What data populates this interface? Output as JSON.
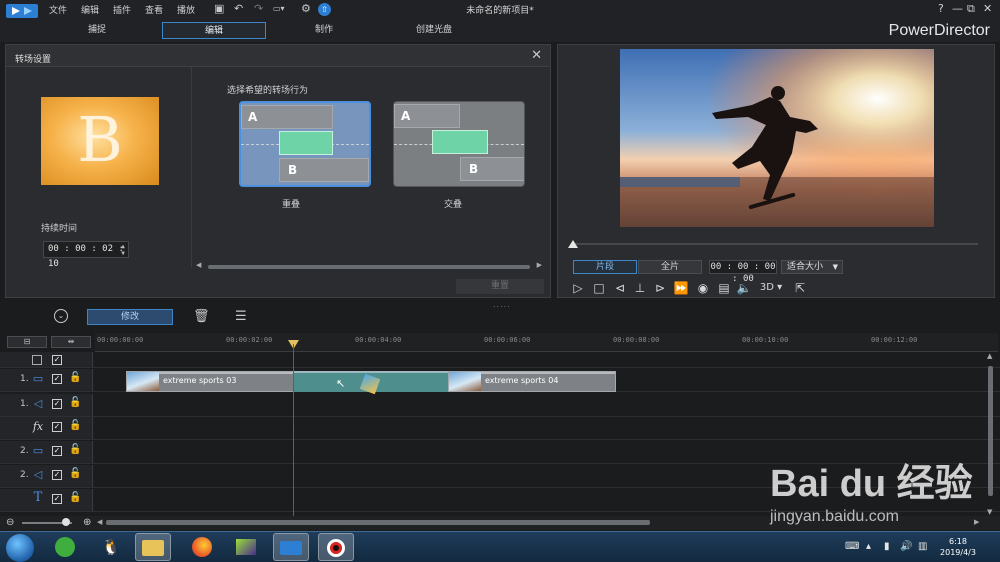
{
  "menubar": {
    "items": [
      "文件",
      "编辑",
      "插件",
      "查看",
      "播放"
    ],
    "project_title": "未命名的新项目*",
    "window_controls": [
      "?",
      "—",
      "⧉",
      "✕"
    ]
  },
  "mode_tabs": [
    "捕捉",
    "编辑",
    "制作",
    "创建光盘"
  ],
  "brand": "PowerDirector",
  "transition_panel": {
    "title": "转场设置",
    "duration_label": "持续时间",
    "duration_value": "00 : 00 : 02 : 10",
    "choose_label": "选择希望的转场行为",
    "option_overlap": "重叠",
    "option_cross": "交叠",
    "letter_a": "A",
    "letter_b": "B",
    "thumb_letter": "B",
    "reset_button": "重置"
  },
  "preview": {
    "seg_clip": "片段",
    "seg_movie": "全片",
    "timecode": "00 : 00 : 00 : 00",
    "fit_label": "适合大小",
    "three_d": "3D"
  },
  "timeline": {
    "modify_button": "修改",
    "ruler_labels": [
      "00:00:00:00",
      "00:00:02:00",
      "00:00:04:00",
      "00:00:06:00",
      "00:00:08:00",
      "00:00:10:00",
      "00:00:12:00"
    ],
    "track_numbers": [
      "1.",
      "1.",
      "2.",
      "2."
    ],
    "clip1_name": "extreme sports 03",
    "clip2_name": "extreme sports 04"
  },
  "taskbar": {
    "time": "6:18",
    "date": "2019/4/3"
  },
  "watermark": {
    "logo": "Bai du 经验",
    "url": "jingyan.baidu.com"
  },
  "colors": {
    "accent": "#3f86c9",
    "playhead": "#c83232",
    "transition_green": "#6fd3a8"
  }
}
